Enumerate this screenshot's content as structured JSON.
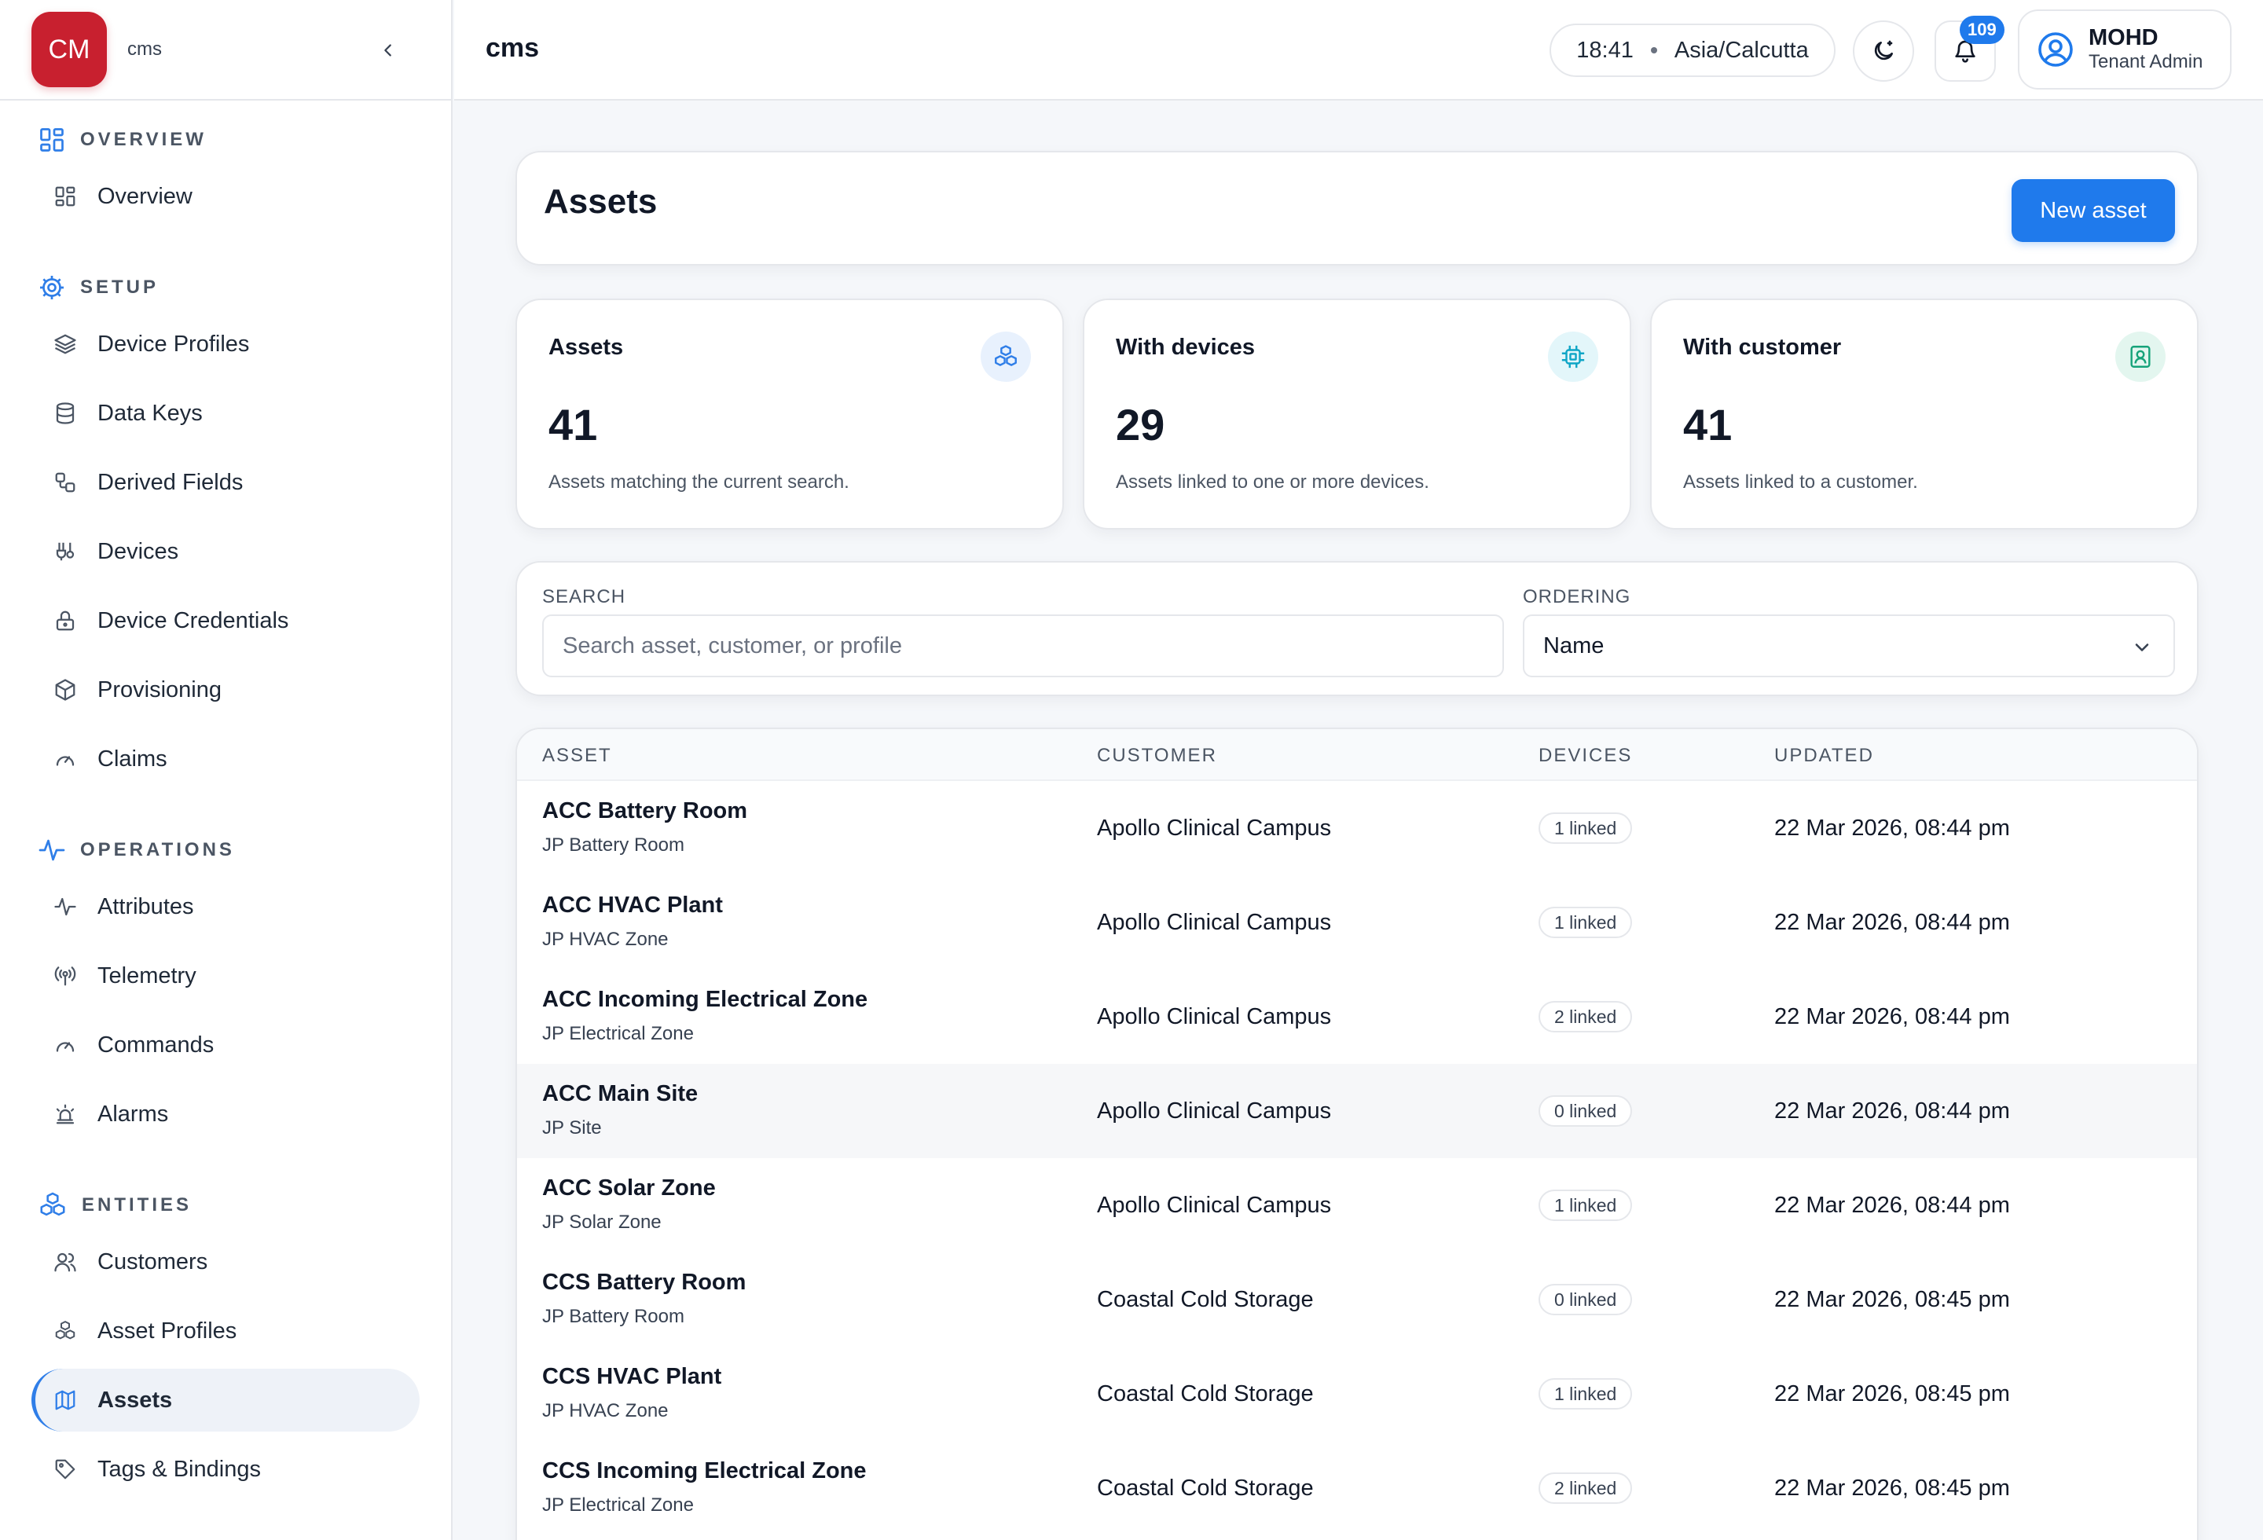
{
  "sidebar": {
    "logo": "CM",
    "tenant": "cms",
    "sections": [
      {
        "title": "OVERVIEW",
        "items": [
          {
            "label": "Overview"
          }
        ]
      },
      {
        "title": "SETUP",
        "items": [
          {
            "label": "Device Profiles"
          },
          {
            "label": "Data Keys"
          },
          {
            "label": "Derived Fields"
          },
          {
            "label": "Devices"
          },
          {
            "label": "Device Credentials"
          },
          {
            "label": "Provisioning"
          },
          {
            "label": "Claims"
          }
        ]
      },
      {
        "title": "OPERATIONS",
        "items": [
          {
            "label": "Attributes"
          },
          {
            "label": "Telemetry"
          },
          {
            "label": "Commands"
          },
          {
            "label": "Alarms"
          }
        ]
      },
      {
        "title": "ENTITIES",
        "items": [
          {
            "label": "Customers"
          },
          {
            "label": "Asset Profiles"
          },
          {
            "label": "Assets",
            "active": true
          },
          {
            "label": "Tags & Bindings"
          }
        ]
      }
    ]
  },
  "topbar": {
    "title": "cms",
    "time": "18:41",
    "timezone": "Asia/Calcutta",
    "notifications": "109",
    "user_name": "MOHD",
    "user_role": "Tenant Admin"
  },
  "page": {
    "title": "Assets",
    "new_button": "New asset"
  },
  "stats": [
    {
      "label": "Assets",
      "value": "41",
      "desc": "Assets matching the current search.",
      "icon": "cubes-icon",
      "color": "#2f7ee8",
      "bg": "#e8f1fd"
    },
    {
      "label": "With devices",
      "value": "29",
      "desc": "Assets linked to one or more devices.",
      "icon": "chip-icon",
      "color": "#0ea5c6",
      "bg": "#e3f6fa"
    },
    {
      "label": "With customer",
      "value": "41",
      "desc": "Assets linked to a customer.",
      "icon": "contact-icon",
      "color": "#16a37a",
      "bg": "#e3f6ef"
    }
  ],
  "filters": {
    "search_label": "SEARCH",
    "search_placeholder": "Search asset, customer, or profile",
    "search_value": "",
    "ordering_label": "ORDERING",
    "ordering_value": "Name"
  },
  "table": {
    "columns": [
      "ASSET",
      "CUSTOMER",
      "DEVICES",
      "UPDATED"
    ],
    "rows": [
      {
        "asset": "ACC Battery Room",
        "profile": "JP Battery Room",
        "customer": "Apollo Clinical Campus",
        "devices": "1 linked",
        "updated": "22 Mar 2026, 08:44 pm"
      },
      {
        "asset": "ACC HVAC Plant",
        "profile": "JP HVAC Zone",
        "customer": "Apollo Clinical Campus",
        "devices": "1 linked",
        "updated": "22 Mar 2026, 08:44 pm"
      },
      {
        "asset": "ACC Incoming Electrical Zone",
        "profile": "JP Electrical Zone",
        "customer": "Apollo Clinical Campus",
        "devices": "2 linked",
        "updated": "22 Mar 2026, 08:44 pm"
      },
      {
        "asset": "ACC Main Site",
        "profile": "JP Site",
        "customer": "Apollo Clinical Campus",
        "devices": "0 linked",
        "updated": "22 Mar 2026, 08:44 pm",
        "hover": true
      },
      {
        "asset": "ACC Solar Zone",
        "profile": "JP Solar Zone",
        "customer": "Apollo Clinical Campus",
        "devices": "1 linked",
        "updated": "22 Mar 2026, 08:44 pm"
      },
      {
        "asset": "CCS Battery Room",
        "profile": "JP Battery Room",
        "customer": "Coastal Cold Storage",
        "devices": "0 linked",
        "updated": "22 Mar 2026, 08:45 pm"
      },
      {
        "asset": "CCS HVAC Plant",
        "profile": "JP HVAC Zone",
        "customer": "Coastal Cold Storage",
        "devices": "1 linked",
        "updated": "22 Mar 2026, 08:45 pm"
      },
      {
        "asset": "CCS Incoming Electrical Zone",
        "profile": "JP Electrical Zone",
        "customer": "Coastal Cold Storage",
        "devices": "2 linked",
        "updated": "22 Mar 2026, 08:45 pm"
      }
    ]
  }
}
